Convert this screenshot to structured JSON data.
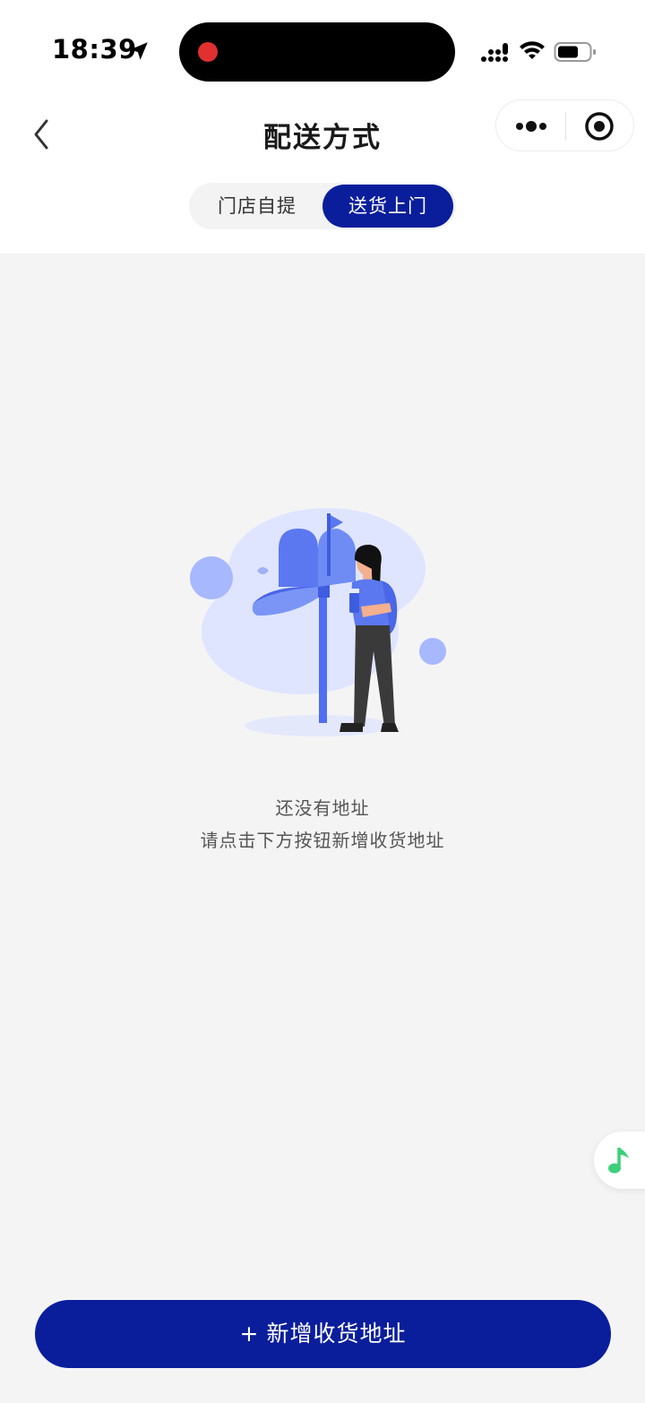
{
  "status_bar": {
    "time": "18:39"
  },
  "nav": {
    "title": "配送方式"
  },
  "tabs": [
    {
      "label": "门店自提",
      "selected": false
    },
    {
      "label": "送货上门",
      "selected": true
    }
  ],
  "empty_state": {
    "title": "还没有地址",
    "hint": "请点击下方按钮新增收货地址"
  },
  "actions": {
    "add_plus": "+",
    "add_label": "新增收货地址"
  },
  "colors": {
    "primary": "#0a1e9c",
    "background": "#f4f4f5",
    "illustration_blue": "#5b78f0",
    "music_green": "#3ecf7a",
    "record_red": "#e0302f"
  },
  "icons": {
    "location": "location-arrow-icon",
    "signal": "cellular-signal-icon",
    "wifi": "wifi-icon",
    "battery": "battery-icon",
    "back": "chevron-left-icon",
    "more": "more-dots-icon",
    "target": "target-icon",
    "music": "music-note-icon"
  }
}
